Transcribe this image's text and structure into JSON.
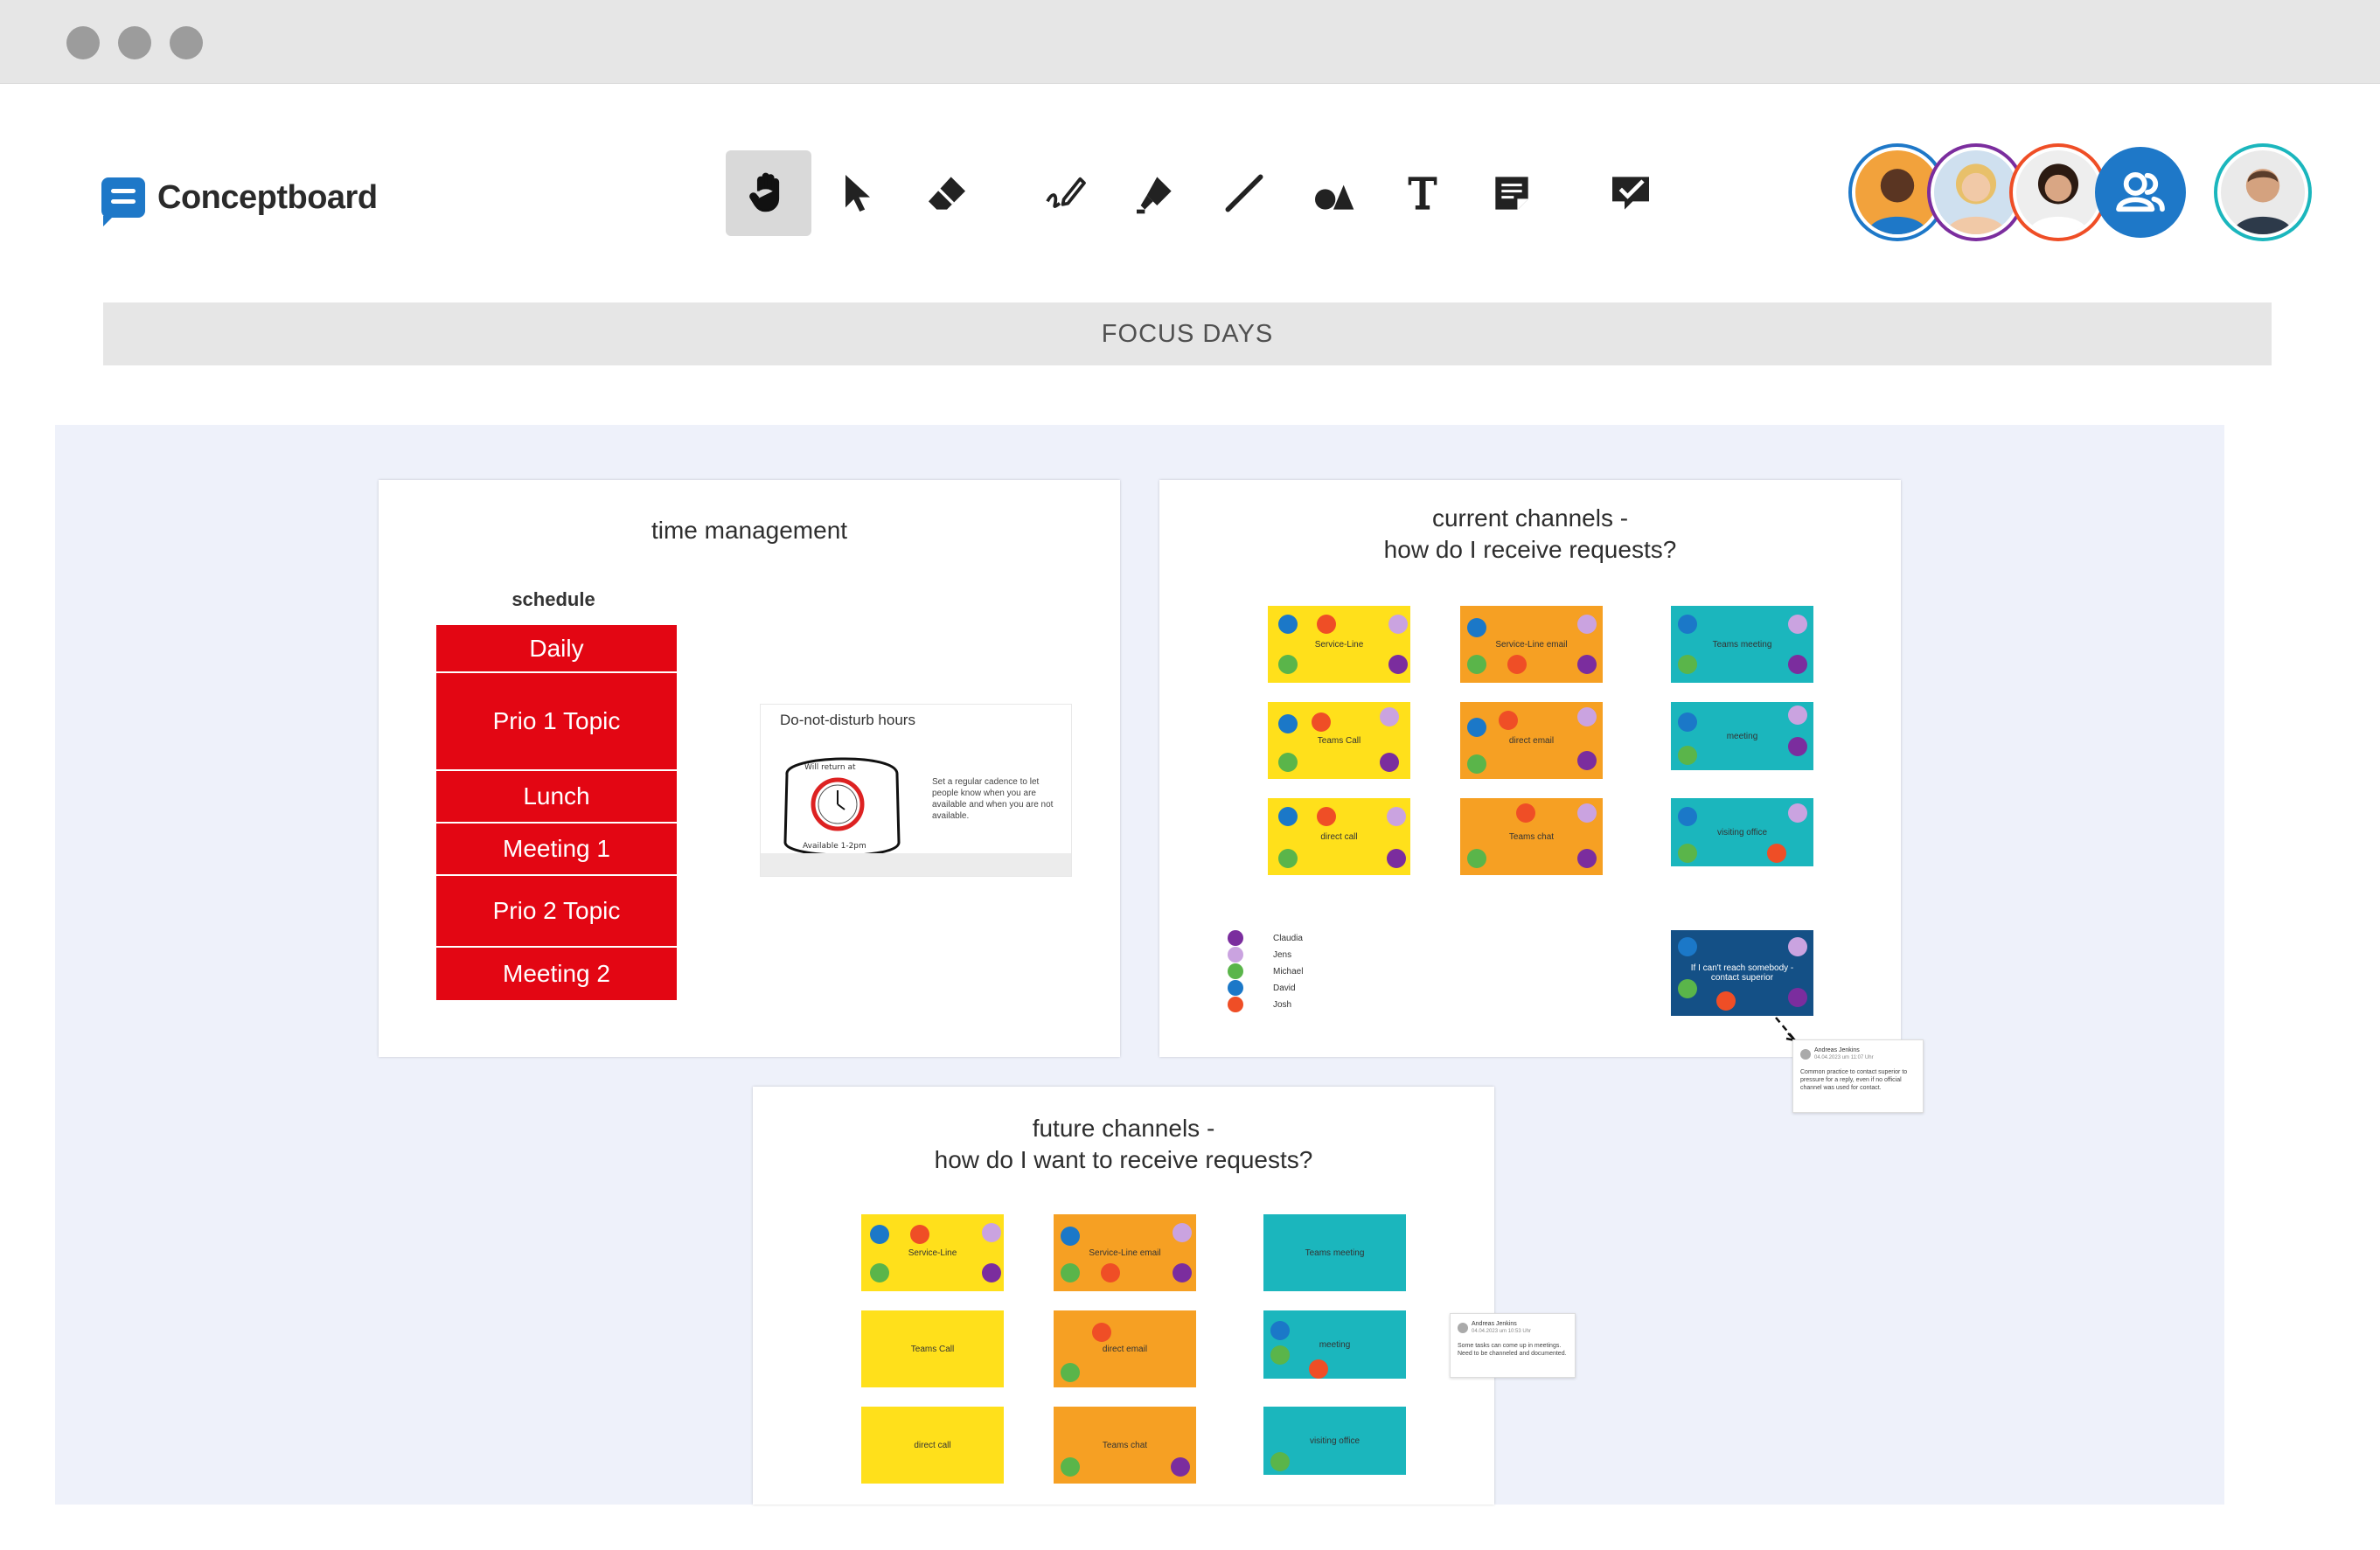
{
  "window": {
    "dots": [
      "close",
      "minimize",
      "maximize"
    ]
  },
  "app": {
    "name": "Conceptboard",
    "icon": "conceptboard-logo"
  },
  "toolbar": {
    "tools": [
      {
        "name": "hand-tool",
        "icon": "hand-icon",
        "active": true
      },
      {
        "name": "select-tool",
        "icon": "cursor-icon",
        "active": false
      },
      {
        "name": "eraser-tool",
        "icon": "eraser-icon",
        "active": false
      },
      {
        "name": "pen-tool",
        "icon": "pen-icon",
        "active": false
      },
      {
        "name": "highlighter-tool",
        "icon": "highlighter-icon",
        "active": false
      },
      {
        "name": "line-tool",
        "icon": "line-icon",
        "active": false
      },
      {
        "name": "shapes-tool",
        "icon": "shapes-icon",
        "active": false
      },
      {
        "name": "text-tool",
        "icon": "text-icon",
        "active": false
      },
      {
        "name": "sticky-note-tool",
        "icon": "sticky-note-icon",
        "active": false
      },
      {
        "name": "comment-tool",
        "icon": "comment-check-icon",
        "active": false
      }
    ]
  },
  "collaborators": [
    {
      "name": "collaborator-1",
      "ring": "#1e78c8"
    },
    {
      "name": "collaborator-2",
      "ring": "#7b2d9e"
    },
    {
      "name": "collaborator-3",
      "ring": "#ef4e26"
    },
    {
      "name": "collaborators-button",
      "ring": "#1e78c8"
    },
    {
      "name": "current-user",
      "ring": "#1bb6bd"
    }
  ],
  "section_title": "FOCUS DAYS",
  "time_management": {
    "title": "time management",
    "schedule_label": "schedule",
    "blocks": [
      "Daily",
      "Prio 1 Topic",
      "Lunch",
      "Meeting 1",
      "Prio 2 Topic",
      "Meeting 2"
    ],
    "dnd": {
      "title": "Do-not-disturb hours",
      "text": "Set a regular cadence to let people know when you are available and when you are not available.",
      "clock_top": "Will return at",
      "clock_bottom": "Available 1-2pm"
    }
  },
  "current_channels": {
    "title": "current channels -\nhow do I receive requests?",
    "notes": [
      "Service-Line",
      "Service-Line email",
      "Teams meeting",
      "Teams Call",
      "direct email",
      "meeting",
      "direct call",
      "Teams chat",
      "visiting office"
    ],
    "escalation_note": "If I can't reach somebody - contact superior",
    "legend": [
      "Claudia",
      "Jens",
      "Michael",
      "David",
      "Josh"
    ],
    "legend_colors": [
      "#7b2d9e",
      "#caa3e0",
      "#5ab54a",
      "#1b78c8",
      "#ef4e26"
    ],
    "comment": {
      "author": "Andreas Jenkins",
      "date": "04.04.2023 um 11:07 Uhr",
      "text": "Common practice to contact superior to pressure for a reply, even if no official channel was used for contact."
    }
  },
  "future_channels": {
    "title": "future channels -\nhow do I want to receive requests?",
    "notes": [
      "Service-Line",
      "Service-Line email",
      "Teams meeting",
      "Teams Call",
      "direct email",
      "meeting",
      "direct call",
      "Teams chat",
      "visiting office"
    ],
    "comment": {
      "author": "Andreas Jenkins",
      "date": "04.04.2023 um 10:53 Uhr",
      "text": "Some tasks can come up in meetings. Need to be channeled and documented."
    }
  },
  "colors": {
    "accent": "#1e78c8",
    "block_red": "#e30613",
    "yellow": "#ffe01b",
    "orange": "#f6a023",
    "teal": "#1bb6bd",
    "navy": "#145086"
  }
}
